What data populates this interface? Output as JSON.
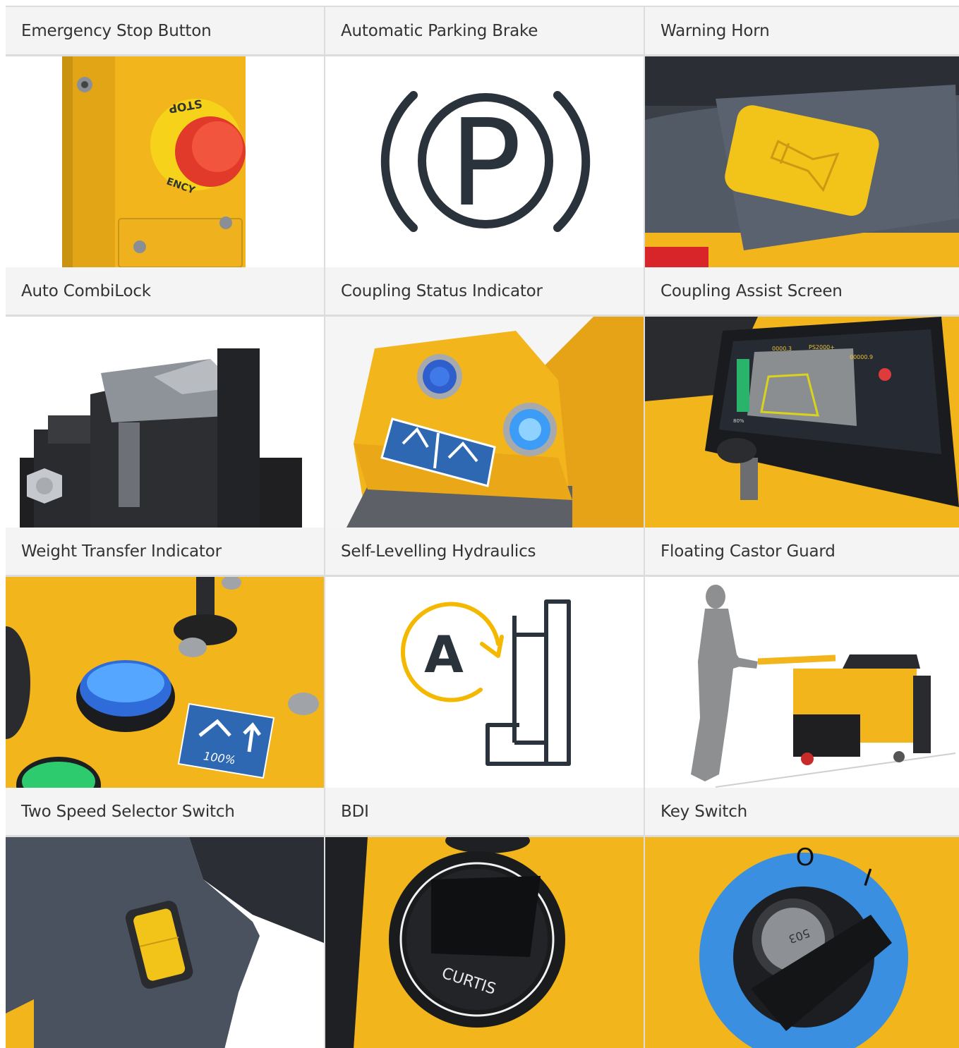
{
  "features": [
    {
      "label": "Emergency Stop Button",
      "icon": "emergency-stop-icon",
      "sticker": "STOP",
      "sticker_bottom": "ENCY"
    },
    {
      "label": "Automatic Parking Brake",
      "icon": "parking-brake-icon",
      "symbol": "P"
    },
    {
      "label": "Warning Horn",
      "icon": "horn-icon"
    },
    {
      "label": "Auto CombiLock",
      "icon": "combilock-icon"
    },
    {
      "label": "Coupling Status Indicator",
      "icon": "coupling-status-icon"
    },
    {
      "label": "Coupling Assist Screen",
      "icon": "coupling-screen-icon",
      "screen_text": [
        "0000.3",
        "PS2000+",
        "00000.9",
        "80%"
      ]
    },
    {
      "label": "Weight Transfer Indicator",
      "icon": "weight-transfer-icon",
      "decal_text": "100%"
    },
    {
      "label": "Self-Levelling Hydraulics",
      "icon": "self-levelling-icon",
      "symbol": "A"
    },
    {
      "label": "Floating Castor Guard",
      "icon": "castor-guard-icon"
    },
    {
      "label": "Two Speed Selector Switch",
      "icon": "speed-selector-icon"
    },
    {
      "label": "BDI",
      "icon": "bdi-icon",
      "brand": "CURTIS"
    },
    {
      "label": "Key Switch",
      "icon": "key-switch-icon",
      "key_text": "503",
      "positions": [
        "O",
        "I"
      ]
    }
  ],
  "colors": {
    "brand_yellow": "#f2b51c",
    "dark_grey": "#4a5260",
    "label_bg": "#f4f4f4",
    "divider": "#dcdcdc",
    "icon_dark": "#2a333b",
    "icon_accent": "#f5b800",
    "led_blue": "#3d8cf5",
    "key_blue": "#3b8fe0"
  }
}
